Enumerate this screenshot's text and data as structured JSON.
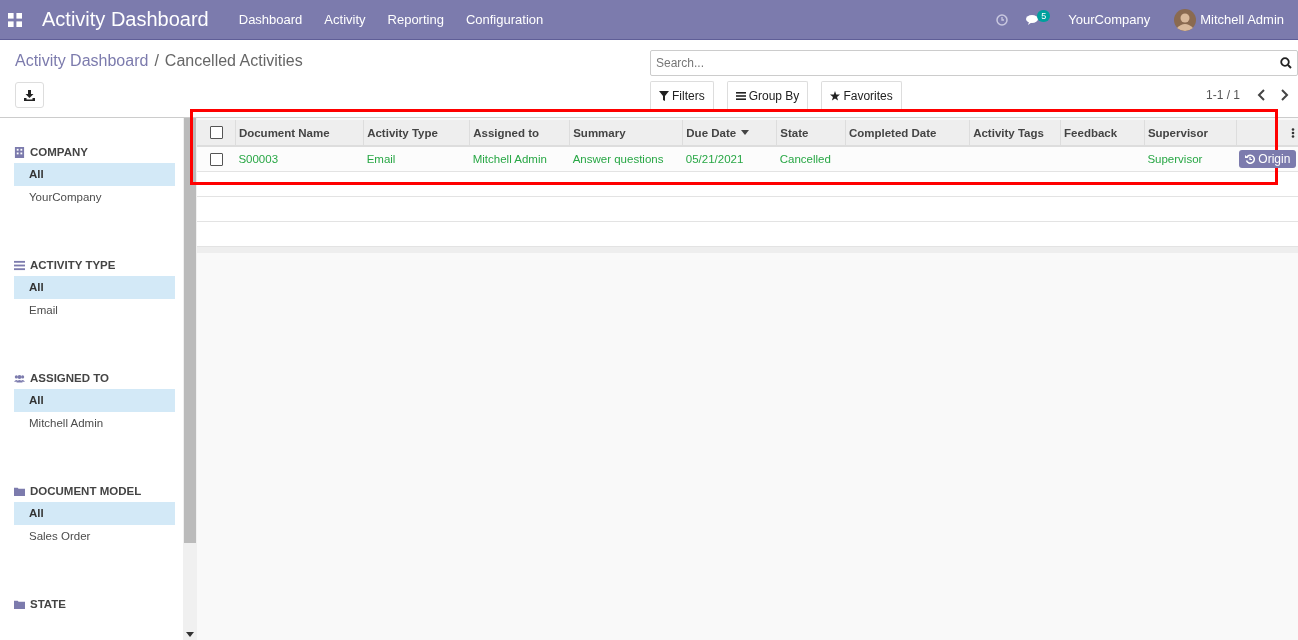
{
  "navbar": {
    "app_title": "Activity Dashboard",
    "menu": [
      "Dashboard",
      "Activity",
      "Reporting",
      "Configuration"
    ],
    "messages_count": "5",
    "company": "YourCompany",
    "user": "Mitchell Admin"
  },
  "breadcrumb": {
    "parent": "Activity Dashboard",
    "separator": "/",
    "current": "Cancelled Activities"
  },
  "search": {
    "placeholder": "Search..."
  },
  "search_buttons": [
    {
      "kind": "filter",
      "label": "Filters"
    },
    {
      "kind": "group",
      "label": "Group By"
    },
    {
      "kind": "favorite",
      "label": "Favorites"
    }
  ],
  "pager": "1-1 / 1",
  "sidebar": [
    {
      "kind": "company",
      "heading": "COMPANY",
      "items": [
        {
          "label": "All",
          "selected": true
        },
        {
          "label": "YourCompany",
          "selected": false
        }
      ]
    },
    {
      "kind": "type",
      "heading": "ACTIVITY TYPE",
      "items": [
        {
          "label": "All",
          "selected": true
        },
        {
          "label": "Email",
          "selected": false
        }
      ]
    },
    {
      "kind": "users",
      "heading": "ASSIGNED TO",
      "items": [
        {
          "label": "All",
          "selected": true
        },
        {
          "label": "Mitchell Admin",
          "selected": false
        }
      ]
    },
    {
      "kind": "folder",
      "heading": "DOCUMENT MODEL",
      "items": [
        {
          "label": "All",
          "selected": true
        },
        {
          "label": "Sales Order",
          "selected": false
        }
      ]
    },
    {
      "kind": "folder",
      "heading": "STATE"
    }
  ],
  "table": {
    "select_all_checked": false,
    "columns": [
      {
        "label": "Document Name",
        "sorted": false
      },
      {
        "label": "Activity Type",
        "sorted": false
      },
      {
        "label": "Assigned to",
        "sorted": false
      },
      {
        "label": "Summary",
        "sorted": false
      },
      {
        "label": "Due Date",
        "sorted": true
      },
      {
        "label": "State",
        "sorted": false
      },
      {
        "label": "Completed Date",
        "sorted": false
      },
      {
        "label": "Activity Tags",
        "sorted": false
      },
      {
        "label": "Feedback",
        "sorted": false
      },
      {
        "label": "Supervisor",
        "sorted": false
      }
    ],
    "rows": [
      {
        "checked": false,
        "cells": [
          "S00003",
          "Email",
          "Mitchell Admin",
          "Answer questions",
          "05/21/2021",
          "Cancelled",
          "",
          "",
          "",
          "Supervisor"
        ],
        "action": "Origin"
      }
    ]
  }
}
